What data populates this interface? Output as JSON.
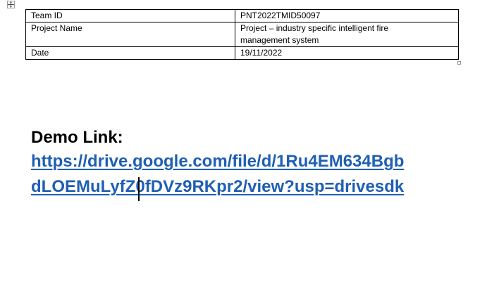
{
  "table": {
    "rows": [
      {
        "label": "Team ID",
        "value_lines": [
          "PNT2022TMID50097"
        ]
      },
      {
        "label": "Project Name",
        "value_lines": [
          "Project – industry specific intelligent fire",
          "management system"
        ]
      },
      {
        "label": "Date",
        "value_lines": [
          "19/11/2022"
        ]
      }
    ]
  },
  "demo": {
    "label": "Demo Link:",
    "link_lines": [
      "https://drive.google.com/file/d/1Ru4EM634Bgb",
      "dLOEMuLyfZ0fDVz9RKpr2/view?usp=drivesdk"
    ]
  },
  "icons": {
    "move_handle": "move-arrows-icon"
  },
  "colors": {
    "link": "#1f5fb4"
  }
}
